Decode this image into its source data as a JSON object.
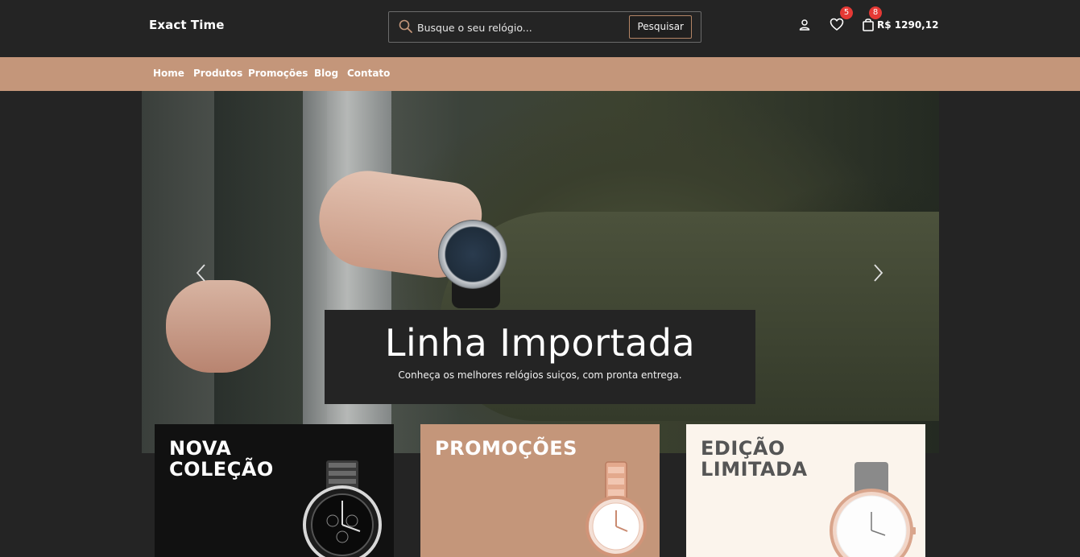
{
  "header": {
    "brand": "Exact Time",
    "search": {
      "placeholder": "Busque o seu relógio...",
      "button_label": "Pesquisar"
    },
    "wishlist_count": "5",
    "cart_count": "8",
    "cart_total": "R$ 1290,12"
  },
  "nav": {
    "items": [
      {
        "label": "Home"
      },
      {
        "label": "Produtos"
      },
      {
        "label": "Promoções"
      },
      {
        "label": "Blog"
      },
      {
        "label": "Contato"
      }
    ]
  },
  "hero": {
    "title": "Linha Importada",
    "subtitle": "Conheça os melhores relógios suiços, com pronta entrega."
  },
  "categories": [
    {
      "title_line1": "NOVA",
      "title_line2": "COLEÇÃO"
    },
    {
      "title_line1": "PROMOÇÕES",
      "title_line2": ""
    },
    {
      "title_line1": "EDIÇÃO",
      "title_line2": "LIMITADA"
    }
  ],
  "colors": {
    "background": "#242424",
    "accent": "#c4967a",
    "badge": "#e53935",
    "card_light": "#fbf4ec",
    "card_dark": "#111111"
  },
  "icons": {
    "search": "search-icon",
    "user": "user-icon",
    "wishlist": "heart-icon",
    "cart": "shopping-bag-icon",
    "prev": "chevron-left-icon",
    "next": "chevron-right-icon"
  }
}
